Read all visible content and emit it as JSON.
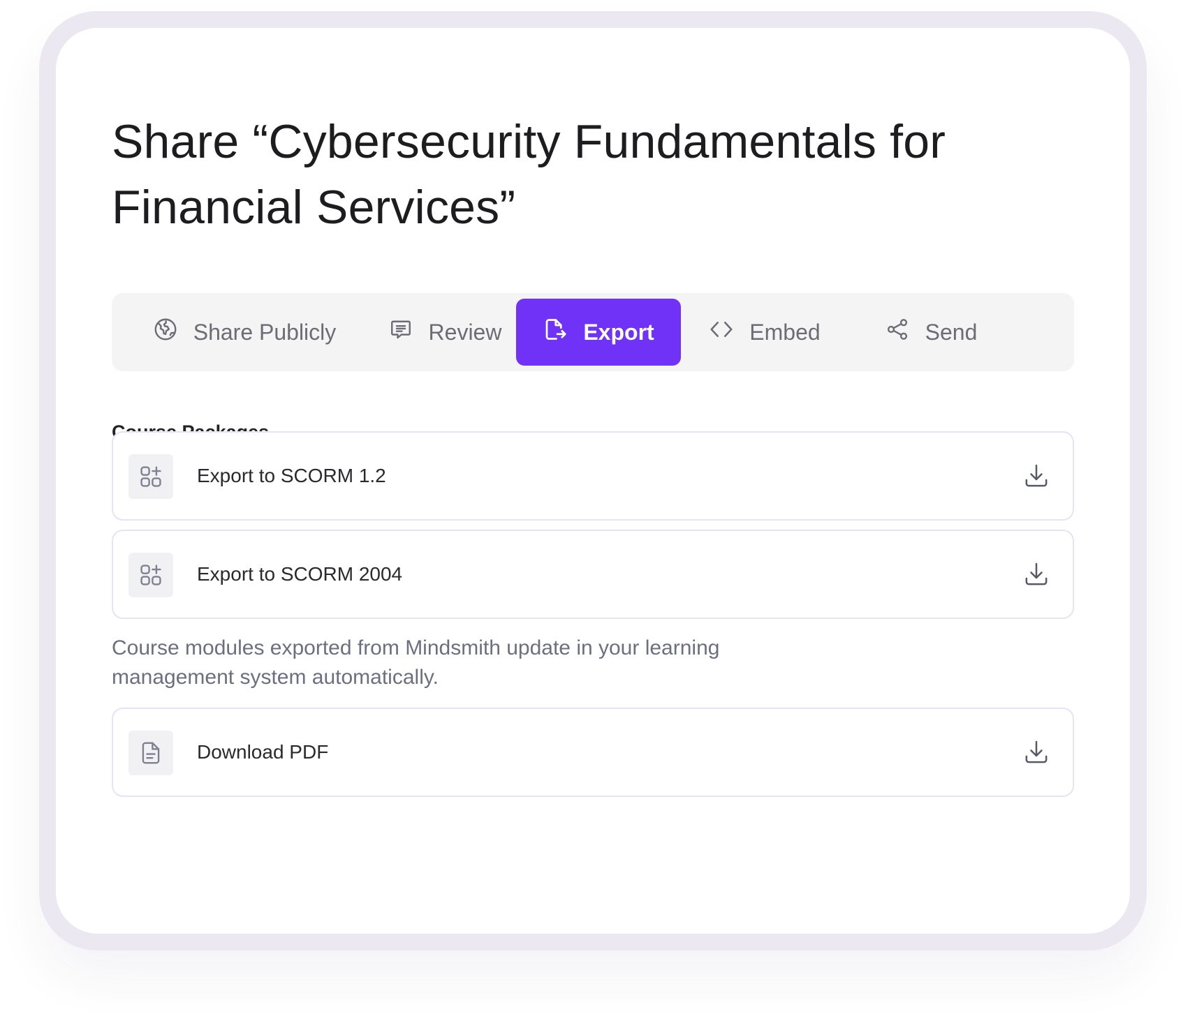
{
  "dialog": {
    "title": "Share “Cybersecurity Fundamentals for Financial Services”"
  },
  "tabs": [
    {
      "label": "Share Publicly",
      "icon": "globe-icon",
      "active": false
    },
    {
      "label": "Review",
      "icon": "comment-icon",
      "active": false
    },
    {
      "label": "Export",
      "icon": "export-icon",
      "active": true
    },
    {
      "label": "Embed",
      "icon": "code-icon",
      "active": false
    },
    {
      "label": "Send",
      "icon": "share-icon",
      "active": false
    }
  ],
  "packages": {
    "heading": "Course Packages",
    "items": [
      {
        "label": "Export to SCORM 1.2",
        "icon": "apps-add-icon",
        "action_icon": "download-icon"
      },
      {
        "label": "Export to SCORM 2004",
        "icon": "apps-add-icon",
        "action_icon": "download-icon"
      }
    ],
    "note": "Course modules exported from Mindsmith update in your learning management system automatically."
  },
  "pdf": {
    "label": "Download PDF",
    "icon": "document-icon",
    "action_icon": "download-icon"
  },
  "colors": {
    "accent": "#7132f7",
    "frame": "#ebe8f2",
    "tab_bar": "#f4f4f5",
    "row_border": "#e5e4f4"
  }
}
